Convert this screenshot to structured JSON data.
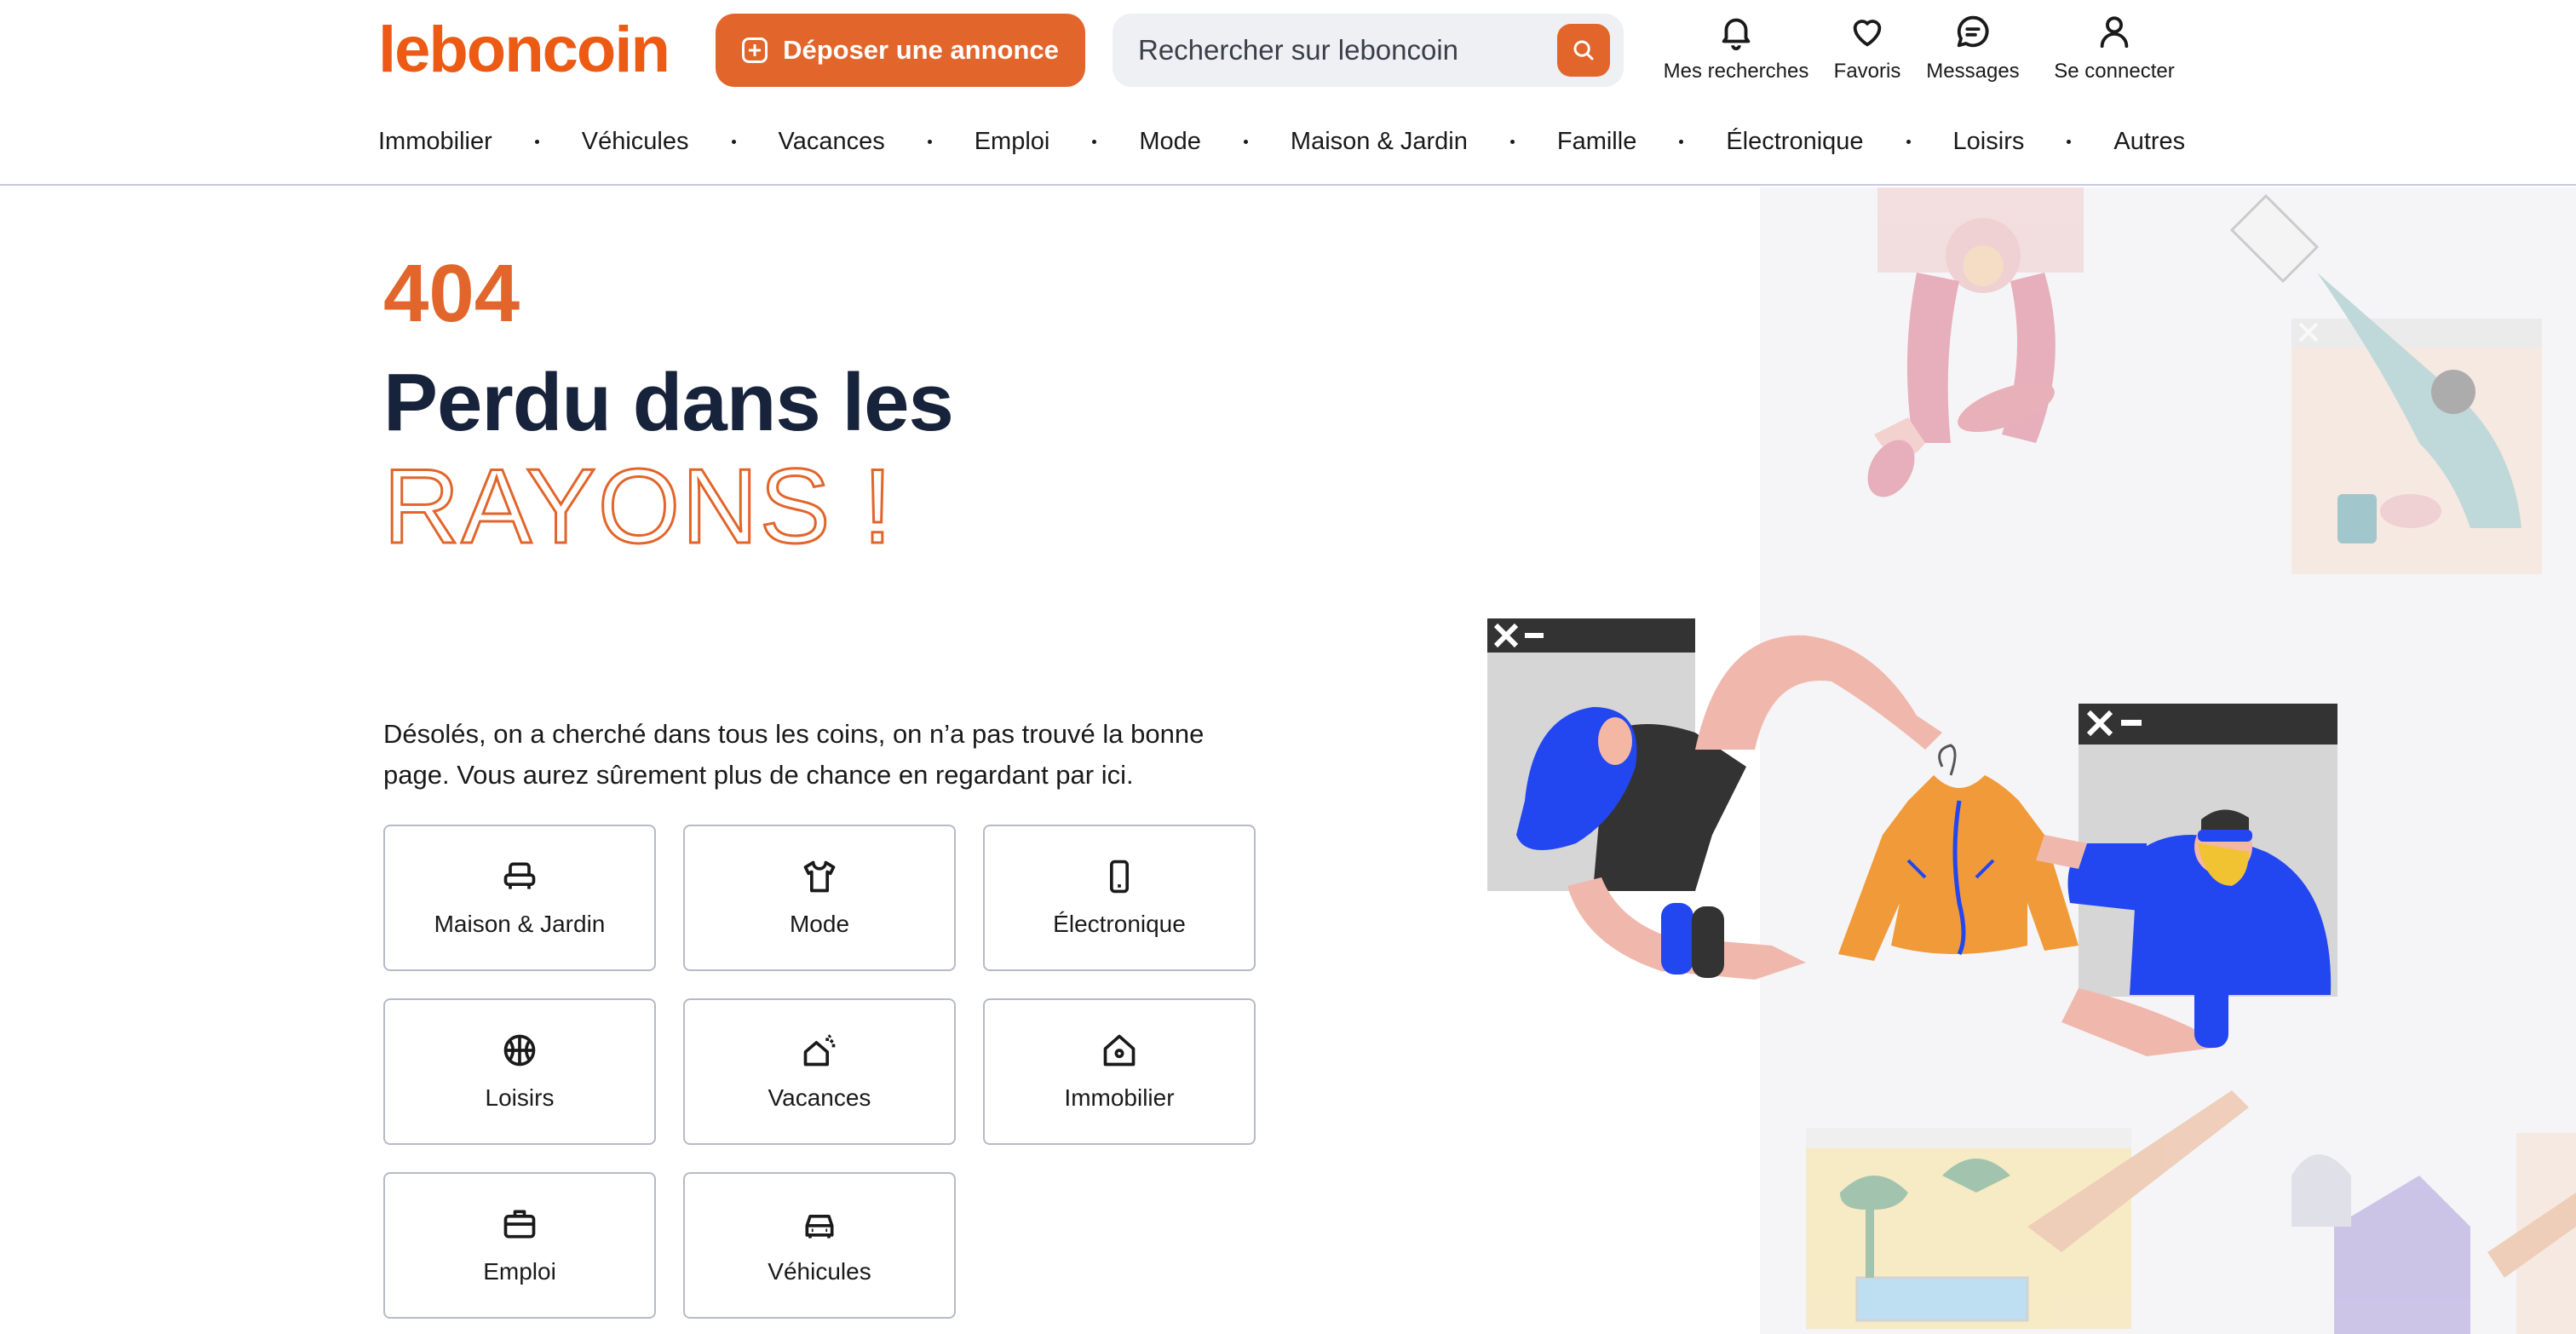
{
  "header": {
    "logo": "leboncoin",
    "post_button": "Déposer une annonce",
    "search_placeholder": "Rechercher sur leboncoin",
    "nav": {
      "saved_searches": "Mes recherches",
      "favorites": "Favoris",
      "messages": "Messages",
      "login": "Se connecter"
    },
    "categories": [
      "Immobilier",
      "Véhicules",
      "Vacances",
      "Emploi",
      "Mode",
      "Maison & Jardin",
      "Famille",
      "Électronique",
      "Loisirs",
      "Autres"
    ]
  },
  "error": {
    "code": "404",
    "headline": "Perdu dans les",
    "headline_outline": "RAYONS !",
    "message": "Désolés, on a cherché dans tous les coins, on n’a pas trouvé la bonne page. Vous aurez sûrement plus de chance en regardant par ici."
  },
  "tiles": [
    {
      "label": "Maison & Jardin",
      "icon": "armchair-icon"
    },
    {
      "label": "Mode",
      "icon": "tshirt-icon"
    },
    {
      "label": "Électronique",
      "icon": "smartphone-icon"
    },
    {
      "label": "Loisirs",
      "icon": "basketball-icon"
    },
    {
      "label": "Vacances",
      "icon": "sun-house-icon"
    },
    {
      "label": "Immobilier",
      "icon": "house-icon"
    },
    {
      "label": "Emploi",
      "icon": "briefcase-icon"
    },
    {
      "label": "Véhicules",
      "icon": "car-icon"
    }
  ],
  "colors": {
    "brand": "#ec5a13",
    "button": "#e2652b",
    "heading": "#17223b"
  }
}
